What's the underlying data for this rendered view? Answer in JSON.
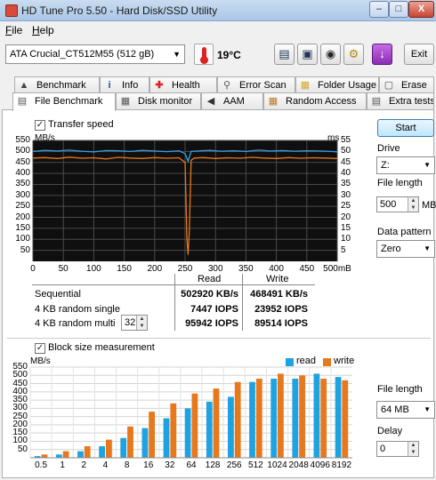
{
  "window": {
    "title": "HD Tune Pro 5.50 - Hard Disk/SSD Utility",
    "minimize": "–",
    "maximize": "□",
    "close": "X"
  },
  "menu": {
    "file_first": "F",
    "file_rest": "ile",
    "help_first": "H",
    "help_rest": "elp"
  },
  "toolbar": {
    "drive": "ATA    Crucial_CT512M55 (512 gB)",
    "temperature": "19°C",
    "exit": "Exit",
    "icons": [
      "copy-info-icon",
      "copy-screen-icon",
      "camera-icon",
      "options-icon",
      "download-icon"
    ]
  },
  "tabs": {
    "row1": [
      {
        "label": "Benchmark",
        "icon": "benchmark-icon"
      },
      {
        "label": "Info",
        "icon": "info-icon"
      },
      {
        "label": "Health",
        "icon": "health-icon"
      },
      {
        "label": "Error Scan",
        "icon": "error-scan-icon"
      },
      {
        "label": "Folder Usage",
        "icon": "folder-icon"
      },
      {
        "label": "Erase",
        "icon": "erase-icon"
      }
    ],
    "row2": [
      {
        "label": "File Benchmark",
        "icon": "file-benchmark-icon"
      },
      {
        "label": "Disk monitor",
        "icon": "disk-monitor-icon"
      },
      {
        "label": "AAM",
        "icon": "aam-icon"
      },
      {
        "label": "Random Access",
        "icon": "random-access-icon"
      },
      {
        "label": "Extra tests",
        "icon": "extra-tests-icon"
      }
    ]
  },
  "transfer": {
    "checkbox_label": "Transfer speed",
    "checked": true,
    "left_unit": "MB/s",
    "right_unit": "ms",
    "x_unit": "mB",
    "y_ticks": [
      "550",
      "500",
      "450",
      "400",
      "350",
      "300",
      "250",
      "200",
      "150",
      "100",
      "50"
    ],
    "y_ticks_right": [
      "55",
      "50",
      "45",
      "40",
      "35",
      "30",
      "25",
      "20",
      "15",
      "10",
      "5"
    ],
    "x_ticks": [
      "0",
      "50",
      "100",
      "150",
      "200",
      "250",
      "300",
      "350",
      "400",
      "450",
      "500"
    ]
  },
  "results": {
    "header_read": "Read",
    "header_write": "Write",
    "rows": [
      {
        "label": "Sequential",
        "read": "502920 KB/s",
        "write": "468491 KB/s"
      },
      {
        "label": "4 KB random single",
        "read": "7447 IOPS",
        "write": "23952 IOPS"
      },
      {
        "label": "4 KB random multi",
        "read": "95942 IOPS",
        "write": "89514 IOPS"
      }
    ],
    "queue_depth": "32"
  },
  "side": {
    "start_label": "Start",
    "drive_label": "Drive",
    "drive_value": "Z:",
    "file_length_label": "File length",
    "file_length_value": "500",
    "file_length_unit": "MB",
    "pattern_label": "Data pattern",
    "pattern_value": "Zero",
    "block_file_length_label": "File length",
    "block_file_length_value": "64 MB",
    "delay_label": "Delay",
    "delay_value": "0"
  },
  "block": {
    "checkbox_label": "Block size measurement",
    "checked": true,
    "unit": "MB/s",
    "legend_read": "read",
    "legend_write": "write",
    "read_color": "#1ea3e0",
    "write_color": "#e8781c"
  },
  "chart_data": [
    {
      "type": "line",
      "title": "",
      "xlabel": "mB",
      "ylabel": "MB/s",
      "y2label": "ms",
      "xlim": [
        0,
        500
      ],
      "ylim": [
        0,
        550
      ],
      "y2lim": [
        0,
        55
      ],
      "grid": true,
      "series": [
        {
          "color": "#3aa0e8",
          "x": [
            0,
            20,
            40,
            60,
            80,
            100,
            120,
            140,
            160,
            180,
            200,
            220,
            240,
            250,
            255,
            260,
            270,
            290,
            310,
            330,
            350,
            370,
            390,
            410,
            430,
            450,
            470,
            490,
            500
          ],
          "values": [
            500,
            505,
            502,
            506,
            501,
            498,
            504,
            503,
            500,
            505,
            502,
            499,
            503,
            490,
            455,
            500,
            502,
            505,
            501,
            503,
            500,
            506,
            502,
            504,
            501,
            503,
            502,
            500,
            498
          ]
        },
        {
          "color": "#e8781c",
          "x": [
            0,
            20,
            40,
            60,
            80,
            100,
            120,
            140,
            160,
            180,
            200,
            220,
            240,
            250,
            253,
            255,
            257,
            260,
            265,
            280,
            300,
            320,
            340,
            360,
            380,
            400,
            420,
            440,
            460,
            480,
            500
          ],
          "values": [
            470,
            472,
            468,
            474,
            469,
            471,
            466,
            473,
            470,
            468,
            472,
            469,
            471,
            450,
            100,
            30,
            140,
            460,
            470,
            472,
            468,
            471,
            469,
            473,
            470,
            468,
            472,
            469,
            471,
            470,
            468
          ]
        }
      ]
    },
    {
      "type": "bar",
      "title": "",
      "ylabel": "MB/s",
      "categories": [
        "0.5",
        "1",
        "2",
        "4",
        "8",
        "16",
        "32",
        "64",
        "128",
        "256",
        "512",
        "1024",
        "2048",
        "4096",
        "8192"
      ],
      "ylim": [
        0,
        550
      ],
      "grid": true,
      "legend": "top-right",
      "series": [
        {
          "name": "read",
          "values": [
            10,
            20,
            40,
            70,
            120,
            180,
            240,
            300,
            340,
            370,
            460,
            480,
            480,
            510,
            490
          ]
        },
        {
          "name": "write",
          "values": [
            20,
            40,
            70,
            110,
            190,
            280,
            330,
            390,
            420,
            460,
            480,
            510,
            500,
            480,
            470
          ]
        }
      ]
    }
  ]
}
